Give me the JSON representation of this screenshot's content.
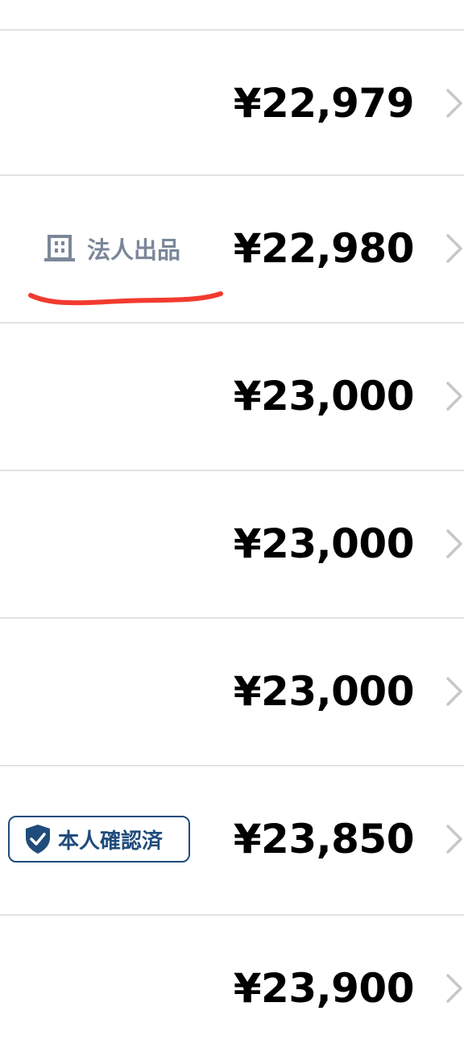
{
  "listings": [
    {
      "price": "¥22,979"
    },
    {
      "price": "¥22,980",
      "badge": "法人出品"
    },
    {
      "price": "¥23,000"
    },
    {
      "price": "¥23,000"
    },
    {
      "price": "¥23,000"
    },
    {
      "price": "¥23,850",
      "badge": "本人確認済"
    },
    {
      "price": "¥23,900"
    }
  ],
  "colors": {
    "price_text": "#000000",
    "divider": "#e2e2e2",
    "chevron": "#c7c7c7",
    "corporate_badge": "#7b8799",
    "verified_badge": "#1f4c7b",
    "annotation_underline": "#f23b2e"
  },
  "icons": {
    "row_arrow": "chevron-right-icon",
    "corporate_badge": "building-icon",
    "verified_badge": "shield-check-icon"
  }
}
